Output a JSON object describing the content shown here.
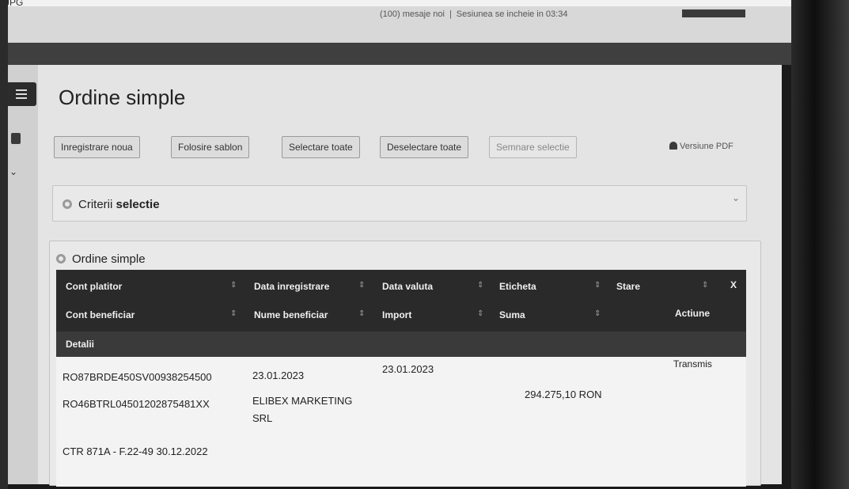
{
  "photo_label": "JPG",
  "top_bar": {
    "messages": "(100) mesaje noi",
    "session": "Sesiunea se incheie in 03:34"
  },
  "page": {
    "title": "Ordine simple"
  },
  "toolbar": {
    "new_label": "Inregistrare noua",
    "template_label": "Folosire sablon",
    "select_all_label": "Selectare toate",
    "deselect_all_label": "Deselectare toate",
    "sign_label": "Semnare selectie",
    "pdf_label": "Versiune PDF"
  },
  "criteria_panel": {
    "title_prefix": "Criterii",
    "title_bold": "selectie"
  },
  "orders_panel": {
    "title": "Ordine simple",
    "close_label": "X",
    "headers_row1": [
      "Cont platitor",
      "Data inregistrare",
      "Data valuta",
      "Eticheta",
      "Stare"
    ],
    "headers_row2": [
      "Cont beneficiar",
      "Nume beneficiar",
      "Import",
      "Suma",
      "Actiune"
    ],
    "headers_row3": [
      "Detalii"
    ],
    "rows": [
      {
        "cont_platitor": "RO87BRDE450SV00938254500",
        "data_inregistrare": "23.01.2023",
        "data_valuta": "23.01.2023",
        "stare": "Transmis",
        "cont_beneficiar": "RO46BTRL04501202875481XX",
        "nume_beneficiar_1": "ELIBEX MARKETING",
        "nume_beneficiar_2": "SRL",
        "suma": "294.275,10 RON",
        "detalii": "CTR 871A - F.22-49 30.12.2022"
      }
    ]
  },
  "colors": {
    "header_bg": "#2a2a2a",
    "page_bg": "#e4e4e4",
    "button_bg": "#dcdcdc"
  }
}
